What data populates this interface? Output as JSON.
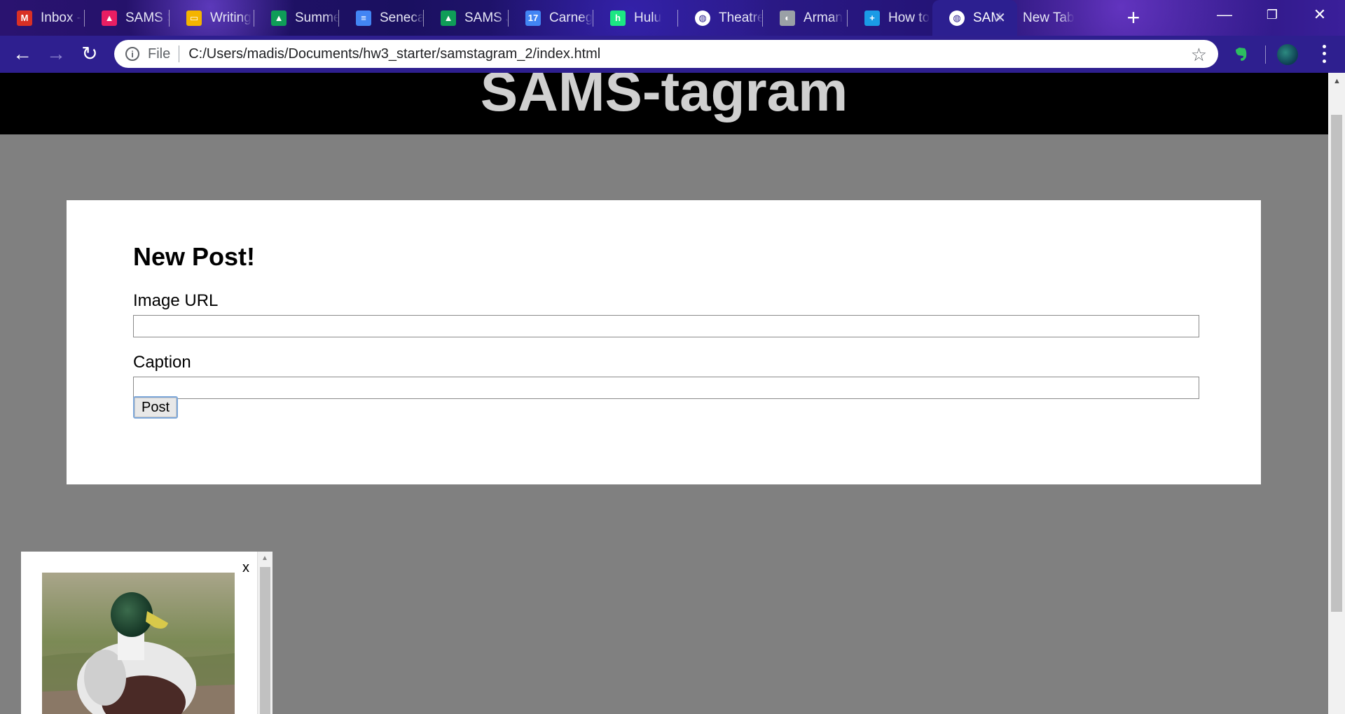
{
  "browser": {
    "tabs": [
      {
        "title": "Inbox -",
        "icon": "gmail-icon",
        "color": "#d93025",
        "glyph": "M"
      },
      {
        "title": "SAMS S",
        "icon": "classroom-icon",
        "color": "#e91e63",
        "glyph": "▲"
      },
      {
        "title": "Writing",
        "icon": "slides-icon",
        "color": "#f4b400",
        "glyph": "▭"
      },
      {
        "title": "Summe",
        "icon": "drive-icon",
        "color": "#0f9d58",
        "glyph": "▲"
      },
      {
        "title": "Seneca",
        "icon": "docs-icon",
        "color": "#4285f4",
        "glyph": "≡"
      },
      {
        "title": "SAMS J",
        "icon": "drive-icon",
        "color": "#0f9d58",
        "glyph": "▲"
      },
      {
        "title": "Carneg",
        "icon": "calendar-icon",
        "color": "#4285f4",
        "glyph": "17"
      },
      {
        "title": "Hulu",
        "icon": "hulu-icon",
        "color": "#1ce783",
        "glyph": "h"
      },
      {
        "title": "Theatre",
        "icon": "globe-icon",
        "color": "#ffffff",
        "glyph": "◍"
      },
      {
        "title": "Arman",
        "icon": "site-icon",
        "color": "#9aa0a6",
        "glyph": "◐"
      },
      {
        "title": "How to",
        "icon": "plus-icon",
        "color": "#1a9be6",
        "glyph": "+"
      },
      {
        "title": "SAM",
        "icon": "globe-icon",
        "color": "#ffffff",
        "glyph": "◍",
        "active": true
      },
      {
        "title": "New Tab",
        "icon": "",
        "color": "",
        "glyph": ""
      }
    ],
    "new_tab_symbol": "+",
    "window_controls": {
      "minimize": "—",
      "restore": "❐",
      "close": "✕"
    },
    "nav": {
      "back": "←",
      "forward": "→",
      "reload": "↻"
    },
    "address": {
      "scheme_label": "File",
      "url": "C:/Users/madis/Documents/hw3_starter/samstagram_2/index.html",
      "info_glyph": "i",
      "star_glyph": "☆"
    },
    "extensions": [
      {
        "icon": "evernote-icon",
        "color": "#2dbe60"
      },
      {
        "icon": "profile-avatar-icon",
        "color": "#1b6e6a"
      }
    ],
    "colors": {
      "frame": "#2e1f8f",
      "tab_strip": "#1a1060"
    }
  },
  "page": {
    "site_title": "SAMS-tagram",
    "form": {
      "heading": "New Post!",
      "image_url_label": "Image URL",
      "image_url_value": "",
      "caption_label": "Caption",
      "caption_value": "",
      "submit_label": "Post"
    },
    "feed": {
      "close_label": "x",
      "image_alt": "mallard duck photo"
    },
    "colors": {
      "background": "#808080",
      "header": "#000000",
      "title": "#d0d0d0",
      "card": "#ffffff"
    }
  }
}
